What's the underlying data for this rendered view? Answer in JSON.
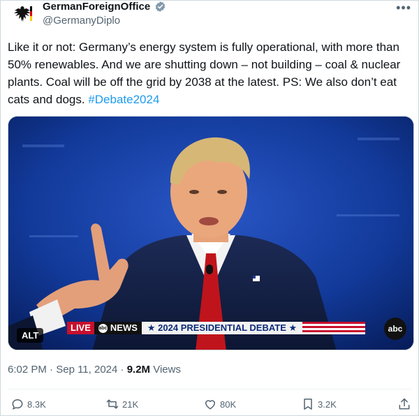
{
  "account": {
    "name": "GermanForeignOffice",
    "handle": "@GermanyDiplo"
  },
  "menu": {
    "more_label": "•••"
  },
  "tweet": {
    "text": "Like it or not: Germany’s energy system is fully operational, with more than 50% renewables. And we are shutting down – not building – coal & nuclear plants. Coal will be off the grid by 2038 at the latest. PS: We also don’t eat cats and dogs. ",
    "hashtag": "#Debate2024"
  },
  "media": {
    "alt_label": "ALT",
    "chyron": {
      "live": "LIVE",
      "network": "NEWS",
      "network_badge": "abc",
      "title": "★ 2024 PRESIDENTIAL DEBATE ★"
    },
    "corner_logo": "abc"
  },
  "meta": {
    "time": "6:02 PM",
    "separator": "·",
    "date": "Sep 11, 2024",
    "views_count": "9.2M",
    "views_label": "Views"
  },
  "actions": {
    "replies": "8.3K",
    "reposts": "21K",
    "likes": "80K",
    "bookmarks": "3.2K"
  },
  "colors": {
    "accent": "#1d9bf0",
    "verified": "#829aab",
    "text": "#0f1419",
    "muted": "#536471"
  }
}
